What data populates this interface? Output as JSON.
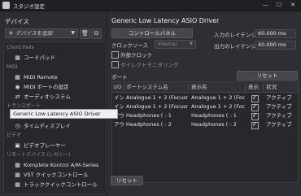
{
  "window": {
    "title": "スタジオ設定",
    "minimize": "—",
    "maximize": "☐",
    "close": "✕"
  },
  "left": {
    "section_title": "デバイス",
    "add_device_label": "デバイスを追加",
    "tree": [
      {
        "type": "cat",
        "label": "Chord Pads"
      },
      {
        "type": "item",
        "icon": "chord-pads-icon",
        "glyph": "▦",
        "label": "コードパッド"
      },
      {
        "type": "cat",
        "label": "MIDI"
      },
      {
        "type": "item",
        "icon": "midi-remote-icon",
        "glyph": "▦",
        "label": "MIDI Remote"
      },
      {
        "type": "item",
        "icon": "midi-port-icon",
        "glyph": "◉",
        "label": "MIDI ポートの設定"
      },
      {
        "type": "item",
        "icon": "audio-system-icon",
        "glyph": "⇄",
        "label": "オーディオシステム"
      },
      {
        "type": "cat",
        "label": "トランスポート"
      },
      {
        "type": "item",
        "icon": "record-time-icon",
        "glyph": "◷",
        "label": "Record Time Max"
      },
      {
        "type": "item",
        "icon": "time-display-icon",
        "glyph": "◷",
        "label": "タイムディスプレイ"
      },
      {
        "type": "cat",
        "label": "ビデオ"
      },
      {
        "type": "item",
        "icon": "video-player-icon",
        "glyph": "▣",
        "label": "ビデオプレーヤー"
      },
      {
        "type": "cat",
        "label": "リモートデバイス (レガシー)"
      },
      {
        "type": "item",
        "icon": "komplete-icon",
        "glyph": "▦",
        "label": "Komplete Kontrol A/M-Series"
      },
      {
        "type": "item",
        "icon": "vst-quick-icon",
        "glyph": "▦",
        "label": "VST クイックコントロール"
      },
      {
        "type": "item",
        "icon": "track-quick-icon",
        "glyph": "▦",
        "label": "トラッククイックコントロール"
      }
    ],
    "selected_item": "Generic Low Latency ASIO Driver",
    "remove_label": "削除"
  },
  "right": {
    "driver_title": "Generic Low Latency ASIO Driver",
    "control_panel_label": "コントロールパネル",
    "clock_source_label": "クロックソース",
    "clock_source_value": "Internal",
    "external_clock_label": "外部クロック",
    "direct_monitoring_label": "ダイレクトモニタリング",
    "input_latency_label": "入力のレイテンシー",
    "input_latency_value": "60.000 ms",
    "output_latency_label": "出力のレイテンシー",
    "output_latency_value": "40.000 ms",
    "ports_label": "ポート",
    "reset_label": "リセット",
    "columns": [
      "I/O",
      "ポートシステム名",
      "表示名",
      "表示",
      "状況"
    ],
    "rows": [
      {
        "io": "イン",
        "system_name": "Analogue 1 + 2 (Focusrite US 1",
        "display_name": "Analogue 1 + 2 (Focusrite",
        "visible": true,
        "status": "アクティブ"
      },
      {
        "io": "イン",
        "system_name": "Analogue 1 + 2 (Focusrite US 2",
        "display_name": "Analogue 1 + 2 (Focusrite",
        "visible": true,
        "status": "アクティブ"
      },
      {
        "io": "アウト",
        "system_name": "Headphones ( - 1",
        "display_name": "Headphones ( - 1",
        "visible": true,
        "status": "アクティブ"
      },
      {
        "io": "アウト",
        "system_name": "Headphones ( - 2",
        "display_name": "Headphones ( - 2",
        "visible": true,
        "status": "アクティブ"
      }
    ],
    "reset_bottom_label": "リセット",
    "apply_label": "適用"
  }
}
